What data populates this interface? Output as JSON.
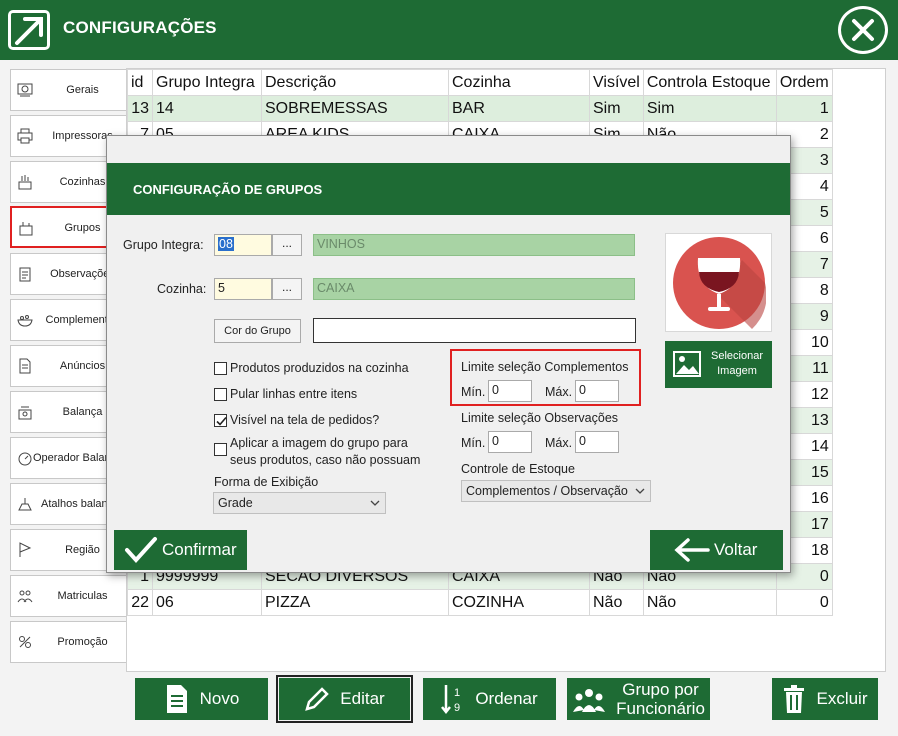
{
  "app": {
    "title": "CONFIGURAÇÕES",
    "accent": "#1e6b34"
  },
  "sidebar": {
    "items": [
      {
        "label": "Gerais",
        "icon": "gear-panel-icon",
        "active": false
      },
      {
        "label": "Impressoras",
        "icon": "printer-icon",
        "active": false
      },
      {
        "label": "Cozinhas",
        "icon": "kitchen-icon",
        "active": false
      },
      {
        "label": "Grupos",
        "icon": "group-icon",
        "active": true
      },
      {
        "label": "Observações",
        "icon": "clipboard-icon",
        "active": false
      },
      {
        "label": "Complementos",
        "icon": "bowl-icon",
        "active": false
      },
      {
        "label": "Anúncios",
        "icon": "document-icon",
        "active": false
      },
      {
        "label": "Balança",
        "icon": "scale-icon",
        "active": false
      },
      {
        "label": "Operador Balança",
        "icon": "scale-operator-icon",
        "active": false
      },
      {
        "label": "Atalhos balança",
        "icon": "scale-shortcut-icon",
        "active": false
      },
      {
        "label": "Região",
        "icon": "flag-icon",
        "active": false
      },
      {
        "label": "Matriculas",
        "icon": "people-icon",
        "active": false
      },
      {
        "label": "Promoção",
        "icon": "promo-icon",
        "active": false
      }
    ]
  },
  "table": {
    "headers": [
      "id",
      "Grupo Integra",
      "Descrição",
      "Cozinha",
      "Visível",
      "Controla Estoque",
      "Ordem"
    ],
    "rows": [
      [
        "13",
        "14",
        "SOBREMESSAS",
        "BAR",
        "Sim",
        "Sim",
        "1"
      ],
      [
        "7",
        "05",
        "AREA KIDS",
        "CAIXA",
        "Sim",
        "Não",
        "2"
      ],
      [
        "",
        "",
        "",
        "",
        "",
        "",
        "3"
      ],
      [
        "",
        "",
        "",
        "",
        "",
        "",
        "4"
      ],
      [
        "",
        "",
        "",
        "",
        "",
        "",
        "5"
      ],
      [
        "",
        "",
        "",
        "",
        "",
        "",
        "6"
      ],
      [
        "",
        "",
        "",
        "",
        "",
        "",
        "7"
      ],
      [
        "",
        "",
        "",
        "",
        "",
        "",
        "8"
      ],
      [
        "",
        "",
        "",
        "",
        "",
        "",
        "9"
      ],
      [
        "",
        "",
        "",
        "",
        "",
        "",
        "10"
      ],
      [
        "",
        "",
        "",
        "",
        "",
        "",
        "11"
      ],
      [
        "",
        "",
        "",
        "",
        "",
        "",
        "12"
      ],
      [
        "",
        "",
        "",
        "",
        "",
        "",
        "13"
      ],
      [
        "",
        "",
        "",
        "",
        "",
        "",
        "14"
      ],
      [
        "",
        "",
        "",
        "",
        "",
        "",
        "15"
      ],
      [
        "",
        "",
        "",
        "",
        "",
        "",
        "16"
      ],
      [
        "",
        "",
        "",
        "",
        "",
        "",
        "17"
      ],
      [
        "",
        "",
        "",
        "",
        "",
        "",
        "18"
      ],
      [
        "1",
        "9999999",
        "SECAO DIVERSOS",
        "CAIXA",
        "Não",
        "Não",
        "0"
      ],
      [
        "22",
        "06",
        "PIZZA",
        "COZINHA",
        "Não",
        "Não",
        "0"
      ]
    ]
  },
  "toolbar": {
    "novo": "Novo",
    "editar": "Editar",
    "ordenar": "Ordenar",
    "grupo_line1": "Grupo por",
    "grupo_line2": "Funcionário",
    "excluir": "Excluir"
  },
  "modal": {
    "title": "CONFIGURAÇÃO DE GRUPOS",
    "grupo_integra_label": "Grupo Integra:",
    "grupo_integra_value": "08",
    "grupo_integra_desc": "VINHOS",
    "cozinha_label": "Cozinha:",
    "cozinha_value": "5",
    "cozinha_desc": "CAIXA",
    "dots": "...",
    "cor_button": "Cor do Grupo",
    "cor_value": "",
    "checkboxes": [
      {
        "label": "Produtos produzidos na cozinha",
        "checked": false
      },
      {
        "label": "Pular linhas entre itens",
        "checked": false
      },
      {
        "label": "Visível na tela de pedidos?",
        "checked": true
      },
      {
        "label": "Aplicar a imagem do grupo para",
        "label2": "seus produtos, caso não possuam",
        "checked": false
      }
    ],
    "forma_label": "Forma de Exibição",
    "forma_value": "Grade",
    "lim_comp_label": "Limite seleção Complementos",
    "lim_obs_label": "Limite seleção Observações",
    "min_label": "Mín.",
    "max_label": "Máx.",
    "comp_min": "0",
    "comp_max": "0",
    "obs_min": "0",
    "obs_max": "0",
    "estoque_label": "Controle de Estoque",
    "estoque_value": "Complementos / Observação",
    "img_btn_line1": "Selecionar",
    "img_btn_line2": "Imagem",
    "confirmar": "Confirmar",
    "voltar": "Voltar"
  }
}
